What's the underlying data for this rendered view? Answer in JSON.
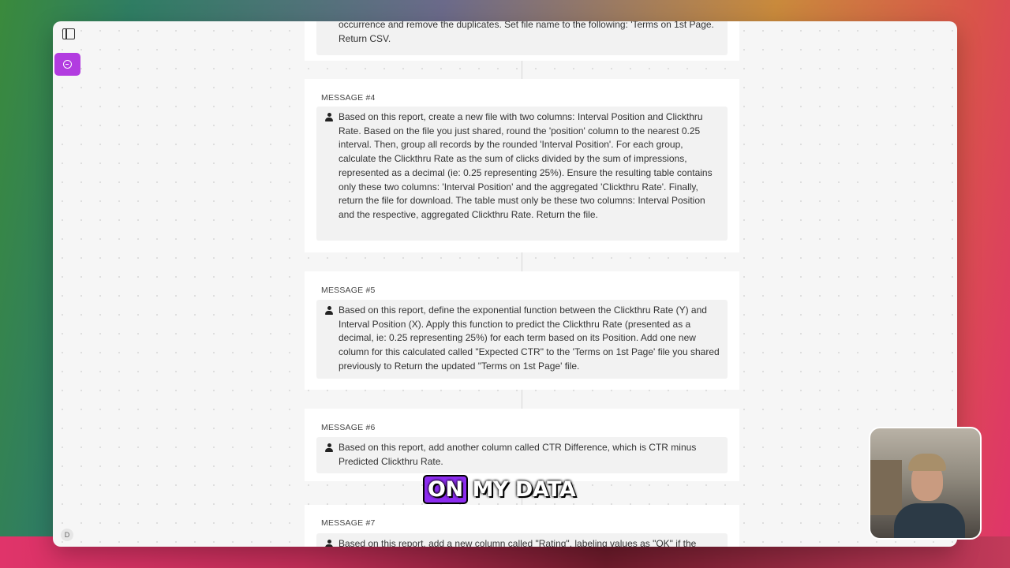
{
  "sidebar": {
    "avatar_initial": "D"
  },
  "messages": [
    {
      "title": "",
      "text": "occurrence and remove the duplicates. Set file name to the following: 'Terms on 1st Page. Return CSV."
    },
    {
      "title": "MESSAGE #4",
      "text": "Based on this report, create a new file with two columns: Interval Position and Clickthru Rate. Based on the file you just shared, round the 'position' column to the nearest 0.25 interval. Then, group all records by the rounded 'Interval Position'. For each group, calculate the Clickthru Rate as the sum of clicks divided by the sum of impressions, represented as a decimal (ie: 0.25 representing 25%). Ensure the resulting table contains only these two columns: 'Interval Position' and the aggregated 'Clickthru Rate'. Finally, return the file for download. The table must only be these two columns: Interval Position and the respective, aggregated Clickthru Rate. Return the file."
    },
    {
      "title": "MESSAGE #5",
      "text": "Based on this report, define the exponential function between the Clickthru Rate (Y) and Interval Position (X). Apply this function to predict the Clickthru Rate (presented as a decimal, ie: 0.25 representing 25%) for each term based on its Position. Add one new column for this calculated called \"Expected CTR\" to the 'Terms on 1st Page' file you shared previously to Return the updated \"Terms on 1st Page' file."
    },
    {
      "title": "MESSAGE #6",
      "text": "Based on this report, add another column called CTR Difference, which is CTR minus Predicted Clickthru Rate."
    },
    {
      "title": "MESSAGE #7",
      "text": "Based on this report, add a new column called \"Rating\", labeling values as \"OK\" if the"
    }
  ],
  "caption": {
    "word1": "ON",
    "word2": "MY DATA"
  },
  "colors": {
    "accent": "#b23ce0",
    "caption_highlight": "#8d2cf0"
  }
}
